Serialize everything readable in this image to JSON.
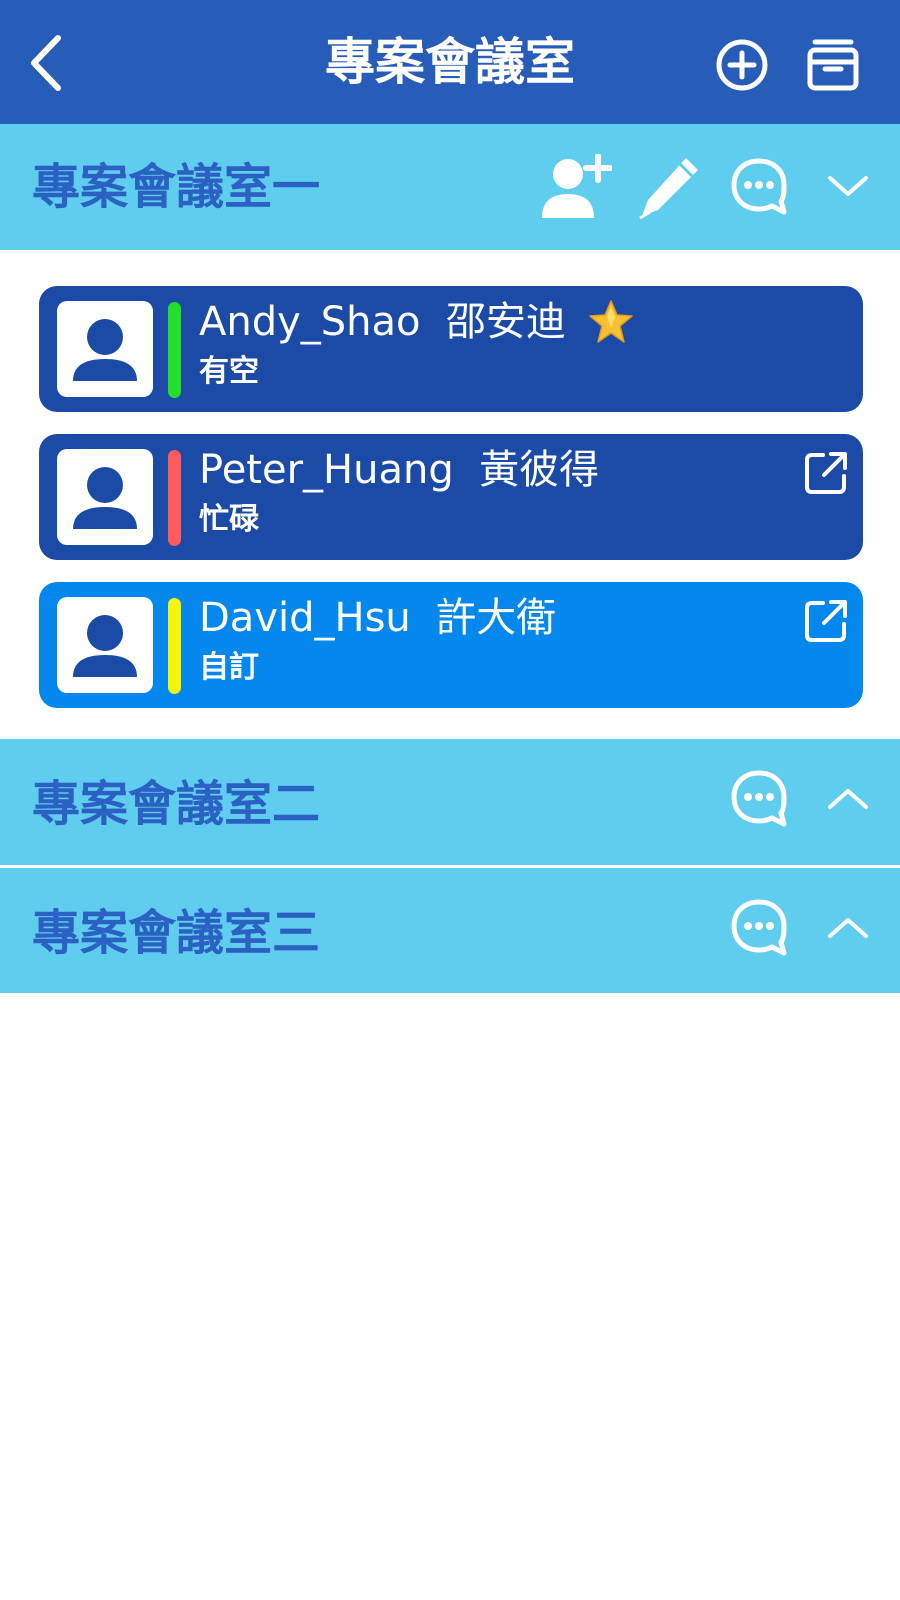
{
  "header": {
    "title": "專案會議室",
    "back_icon": "chevron-left-icon",
    "add_icon": "plus-circle-icon",
    "archive_icon": "archive-box-icon"
  },
  "rooms": [
    {
      "title": "專案會議室一",
      "expanded": true,
      "icons": [
        "add-person-icon",
        "pencil-icon",
        "chat-bubble-icon",
        "chevron-down-icon"
      ],
      "members": [
        {
          "name": "Andy_Shao  邵安迪",
          "status": "有空",
          "status_color": "#22e02a",
          "badge": "star-icon"
        },
        {
          "name": "Peter_Huang  黃彼得",
          "status": "忙碌",
          "status_color": "#ff5b5b",
          "badge": "external-link-icon"
        },
        {
          "name": "David_Hsu  許大衛",
          "status": "自訂",
          "status_color": "#f5f50a",
          "badge": "external-link-icon"
        }
      ]
    },
    {
      "title": "專案會議室二",
      "expanded": false,
      "icons": [
        "chat-bubble-icon",
        "chevron-up-icon"
      ]
    },
    {
      "title": "專案會議室三",
      "expanded": false,
      "icons": [
        "chat-bubble-icon",
        "chevron-up-icon"
      ]
    }
  ],
  "colors": {
    "header_bg": "#275cb8",
    "group_bg": "#5ecdee",
    "group_title": "#2a61c3",
    "member_dark": "#1b4ba7",
    "member_highlight": "#0488ee"
  }
}
